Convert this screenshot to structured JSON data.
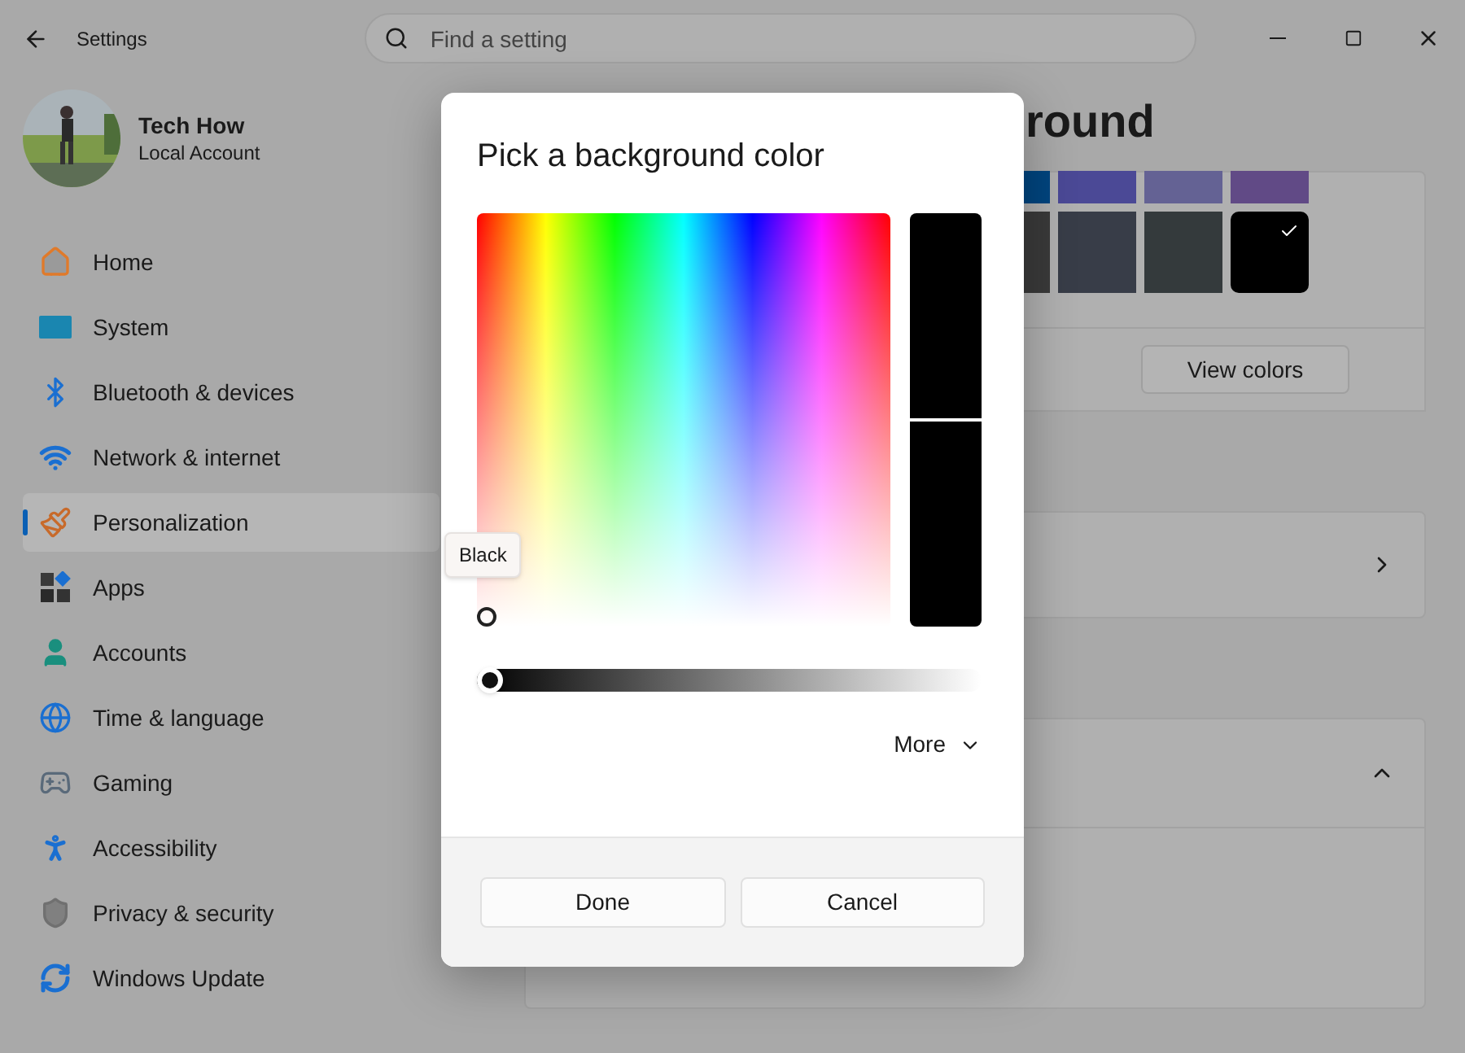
{
  "window": {
    "title": "Settings"
  },
  "search": {
    "placeholder": "Find a setting"
  },
  "profile": {
    "name": "Tech How",
    "account": "Local Account"
  },
  "sidebar": {
    "items": [
      {
        "label": "Home",
        "selected": false
      },
      {
        "label": "System",
        "selected": false
      },
      {
        "label": "Bluetooth & devices",
        "selected": false
      },
      {
        "label": "Network & internet",
        "selected": false
      },
      {
        "label": "Personalization",
        "selected": true
      },
      {
        "label": "Apps",
        "selected": false
      },
      {
        "label": "Accounts",
        "selected": false
      },
      {
        "label": "Time & language",
        "selected": false
      },
      {
        "label": "Gaming",
        "selected": false
      },
      {
        "label": "Accessibility",
        "selected": false
      },
      {
        "label": "Privacy & security",
        "selected": false
      },
      {
        "label": "Windows Update",
        "selected": false
      }
    ]
  },
  "page": {
    "heading": "round",
    "swatches": [
      {
        "color": "#00457f",
        "selected": false
      },
      {
        "color": "#4b4996",
        "selected": false
      },
      {
        "color": "#646294",
        "selected": false
      },
      {
        "color": "#614a86",
        "selected": false
      },
      {
        "color": "#3a3a3a",
        "selected": false
      },
      {
        "color": "#383d48",
        "selected": false
      },
      {
        "color": "#343a3c",
        "selected": false
      },
      {
        "color": "#000000",
        "selected": true
      }
    ],
    "view_colors_button": "View colors"
  },
  "dialog": {
    "title": "Pick a background color",
    "tooltip": "Black",
    "brightness": {
      "level": 0
    },
    "more": "More",
    "buttons": [
      "Done",
      "Cancel"
    ]
  }
}
